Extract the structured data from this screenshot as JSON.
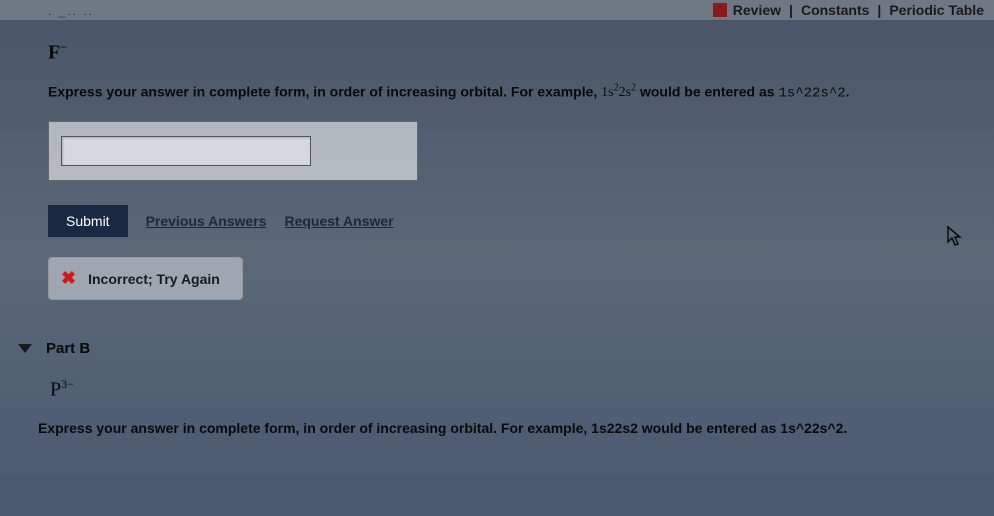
{
  "topbar": {
    "review": "Review",
    "constants": "Constants",
    "periodic_table": "Periodic Table"
  },
  "part_a": {
    "ion_base": "F",
    "ion_sup": "−",
    "instruction_prefix": "Express your answer in complete form, in order of increasing orbital. For example, ",
    "formula_plain": "1s",
    "formula_sup1": "2",
    "formula_mid": "2s",
    "formula_sup2": "2",
    "instruction_mid": " would be entered as ",
    "example_input": "1s^22s^2",
    "instruction_end": ".",
    "input_value": "",
    "submit_label": "Submit",
    "previous_answers": "Previous Answers",
    "request_answer": "Request Answer",
    "feedback": "Incorrect; Try Again"
  },
  "part_b": {
    "title": "Part B",
    "ion_base": "P",
    "ion_sup": "3−",
    "instruction_prefix": "Express your answer in complete form, in order of increasing orbital. For example, ",
    "formula_plain": "1s",
    "formula_sup1": "2",
    "formula_mid": "2s",
    "formula_sup2": "2",
    "instruction_mid": " would be entered as ",
    "example_input": "1s^22s^2",
    "instruction_end": "."
  }
}
